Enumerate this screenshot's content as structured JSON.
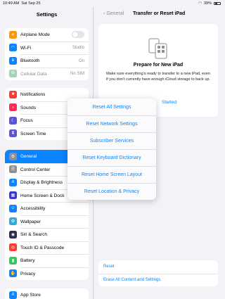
{
  "status_bar": {
    "time": "10:49 AM",
    "date": "Sat Sep 25",
    "battery": "39%"
  },
  "sidebar": {
    "title": "Settings",
    "group1": [
      {
        "label": "Airplane Mode",
        "icon": "airplane-icon",
        "color": "#ff9500",
        "glyph": "✈",
        "control": "toggle"
      },
      {
        "label": "Wi-Fi",
        "icon": "wifi-icon",
        "color": "#0a84ff",
        "glyph": "◠",
        "value": "Studio"
      },
      {
        "label": "Bluetooth",
        "icon": "bluetooth-icon",
        "color": "#0a84ff",
        "glyph": "ʙ",
        "value": "On"
      },
      {
        "label": "Cellular Data",
        "icon": "cellular-icon",
        "color": "#9fd5b1",
        "glyph": "⦾",
        "value": "No SIM",
        "dimmed": true
      }
    ],
    "group2": [
      {
        "label": "Notifications",
        "icon": "notifications-icon",
        "color": "#ff3b30",
        "glyph": "■"
      },
      {
        "label": "Sounds",
        "icon": "sounds-icon",
        "color": "#ff2d55",
        "glyph": "♪"
      },
      {
        "label": "Focus",
        "icon": "focus-icon",
        "color": "#5856d6",
        "glyph": "☾"
      },
      {
        "label": "Screen Time",
        "icon": "screen-time-icon",
        "color": "#5856d6",
        "glyph": "⧗"
      }
    ],
    "group3": [
      {
        "label": "General",
        "icon": "gear-icon",
        "color": "#8e8e93",
        "glyph": "⚙",
        "selected": true
      },
      {
        "label": "Control Center",
        "icon": "control-center-icon",
        "color": "#8e8e93",
        "glyph": "☰"
      },
      {
        "label": "Display & Brightness",
        "icon": "display-icon",
        "color": "#0a84ff",
        "glyph": "A"
      },
      {
        "label": "Home Screen & Dock",
        "icon": "home-screen-icon",
        "color": "#3a3ad0",
        "glyph": "▦"
      },
      {
        "label": "Accessibility",
        "icon": "accessibility-icon",
        "color": "#0a84ff",
        "glyph": "☺"
      },
      {
        "label": "Wallpaper",
        "icon": "wallpaper-icon",
        "color": "#34aadc",
        "glyph": "✿"
      },
      {
        "label": "Siri & Search",
        "icon": "siri-icon",
        "color": "#2c2c54",
        "glyph": "◉"
      },
      {
        "label": "Touch ID & Passcode",
        "icon": "fingerprint-icon",
        "color": "#ff3b30",
        "glyph": "◎"
      },
      {
        "label": "Battery",
        "icon": "battery-icon",
        "color": "#34c759",
        "glyph": "▮"
      },
      {
        "label": "Privacy",
        "icon": "privacy-icon",
        "color": "#0a84ff",
        "glyph": "✋"
      }
    ],
    "group4": [
      {
        "label": "App Store",
        "icon": "app-store-icon",
        "color": "#0a84ff",
        "glyph": "A"
      }
    ]
  },
  "main": {
    "back_label": "General",
    "title": "Transfer or Reset iPad",
    "prepare": {
      "title": "Prepare for New iPad",
      "description": "Make sure everything’s ready to transfer to a new iPad, even if you don’t currently have enough iCloud storage to back up.",
      "action": "Started"
    },
    "bottom": {
      "reset": "Reset",
      "erase": "Erase All Content and Settings"
    }
  },
  "reset_menu": {
    "items": [
      "Reset All Settings",
      "Reset Network Settings",
      "Subscriber Services",
      "Reset Keyboard Dictionary",
      "Reset Home Screen Layout",
      "Reset Location & Privacy"
    ]
  }
}
